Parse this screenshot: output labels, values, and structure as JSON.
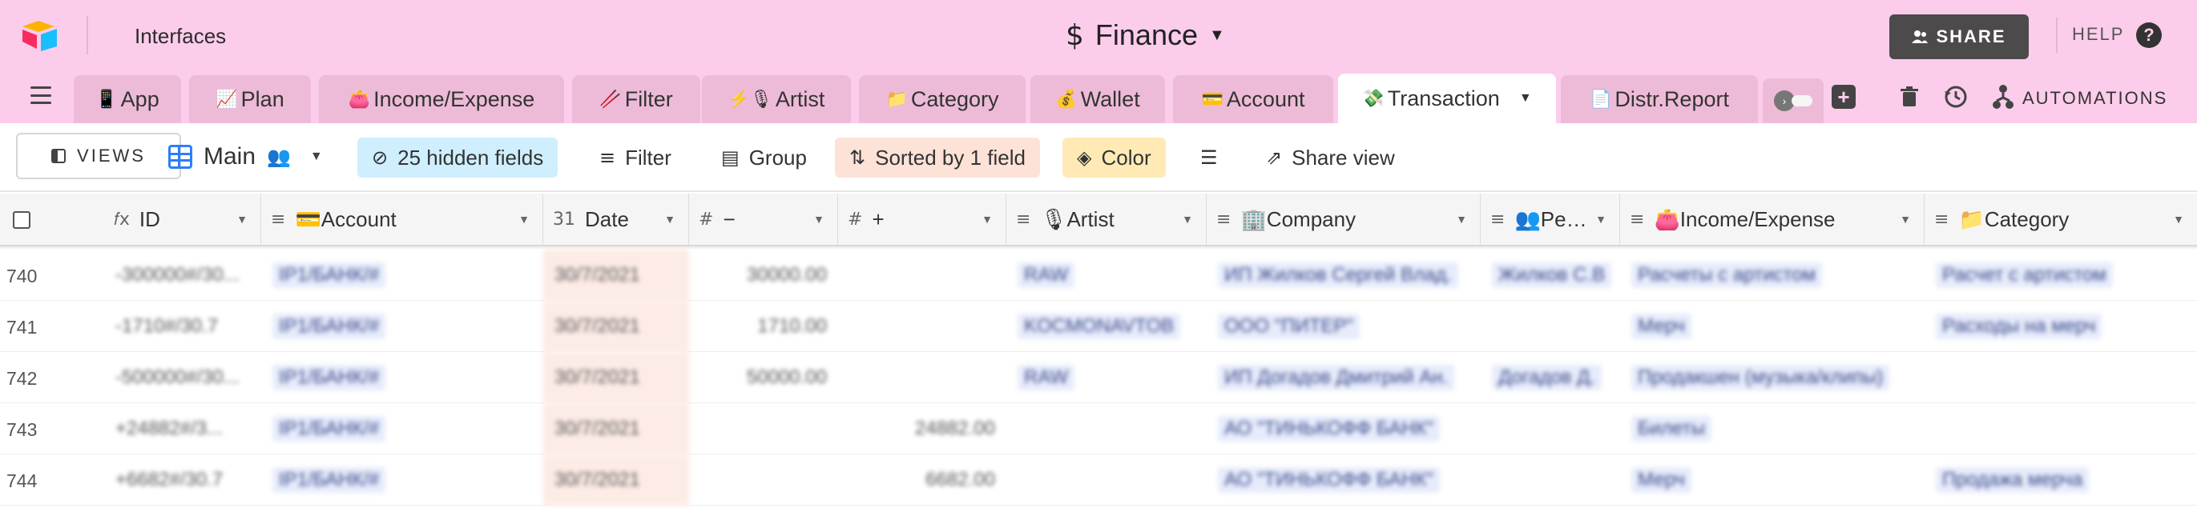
{
  "topbar": {
    "interfaces_label": "Interfaces",
    "base_icon": "$",
    "base_name": "Finance",
    "share_label": "SHARE",
    "help_label": "HELP",
    "help_icon": "?"
  },
  "tabs": [
    {
      "icon": "📱",
      "label": "App"
    },
    {
      "icon": "📈",
      "label": "Plan"
    },
    {
      "icon": "👛",
      "label": "Income/Expense"
    },
    {
      "icon": "🥢",
      "label": "Filter"
    },
    {
      "icon": "⚡️🎙",
      "label": "Artist"
    },
    {
      "icon": "📁",
      "label": "Category"
    },
    {
      "icon": "💰",
      "label": "Wallet"
    },
    {
      "icon": "💳",
      "label": "Account"
    },
    {
      "icon": "💸",
      "label": "Transaction"
    },
    {
      "icon": "📄",
      "label": "Distr.Report"
    }
  ],
  "active_tab_index": 8,
  "toolbar": {
    "automations_label": "AUTOMATIONS"
  },
  "viewbar": {
    "views_label": "VIEWS",
    "view_name": "Main",
    "hidden_fields_label": "25 hidden fields",
    "filter_label": "Filter",
    "group_label": "Group",
    "sorted_label": "Sorted by 1 field",
    "color_label": "Color",
    "share_view_label": "Share view"
  },
  "columns": [
    {
      "type_icon": "𝑓x",
      "label": "ID"
    },
    {
      "type_icon": "≡",
      "label": "💳Account"
    },
    {
      "type_icon": "31",
      "label": "Date"
    },
    {
      "type_icon": "#",
      "label": "−"
    },
    {
      "type_icon": "#",
      "label": "+"
    },
    {
      "type_icon": "≡",
      "label": "🎙Artist"
    },
    {
      "type_icon": "≡",
      "label": "🏢Company"
    },
    {
      "type_icon": "≡",
      "label": "👥Pe…"
    },
    {
      "type_icon": "≡",
      "label": "👛Income/Expense"
    },
    {
      "type_icon": "≡",
      "label": "📁Category"
    }
  ],
  "rows": [
    {
      "num": "740",
      "id": "-300000#/30...",
      "account": "IP1/БАНК/#",
      "date": "30/7/2021",
      "minus": "30000.00",
      "plus": "",
      "artist": "RAW",
      "company": "ИП Жилков Сергей Влад.",
      "person": "Жилков С.В",
      "income": "Расчеты с артистом",
      "category": "Расчет с артистом"
    },
    {
      "num": "741",
      "id": "-1710#/30.7",
      "account": "IP1/БАНК/#",
      "date": "30/7/2021",
      "minus": "1710.00",
      "plus": "",
      "artist": "KOCMONAVTOB",
      "company": "ООО \"ПИТЕР\"",
      "person": "",
      "income": "Мерч",
      "category": "Расходы на мерч"
    },
    {
      "num": "742",
      "id": "-500000#/30...",
      "account": "IP1/БАНК/#",
      "date": "30/7/2021",
      "minus": "50000.00",
      "plus": "",
      "artist": "RAW",
      "company": "ИП Догадов Дмитрий Ан.",
      "person": "Догадов Д.",
      "income": "Продакшен (музыка/клипы)",
      "category": ""
    },
    {
      "num": "743",
      "id": "+24882#/3...",
      "account": "IP1/БАНК/#",
      "date": "30/7/2021",
      "minus": "",
      "plus": "24882.00",
      "artist": "",
      "company": "АО \"ТИНЬКОФФ БАНК\"",
      "person": "",
      "income": "Билеты",
      "category": ""
    },
    {
      "num": "744",
      "id": "+6682#/30.7",
      "account": "IP1/БАНК/#",
      "date": "30/7/2021",
      "minus": "",
      "plus": "6682.00",
      "artist": "",
      "company": "АО \"ТИНЬКОФФ БАНК\"",
      "person": "",
      "income": "Мерч",
      "category": "Продажа мерча"
    }
  ],
  "colors": {
    "header_bg": "#fccdeb",
    "tab_bg": "#edbbd7",
    "share_btn": "#4d4a4c",
    "hidden_fields_bg": "#cfeefe",
    "sorted_bg": "#fde2d8",
    "color_bg": "#ffeab6",
    "grid_icon": "#2d7ff9"
  }
}
